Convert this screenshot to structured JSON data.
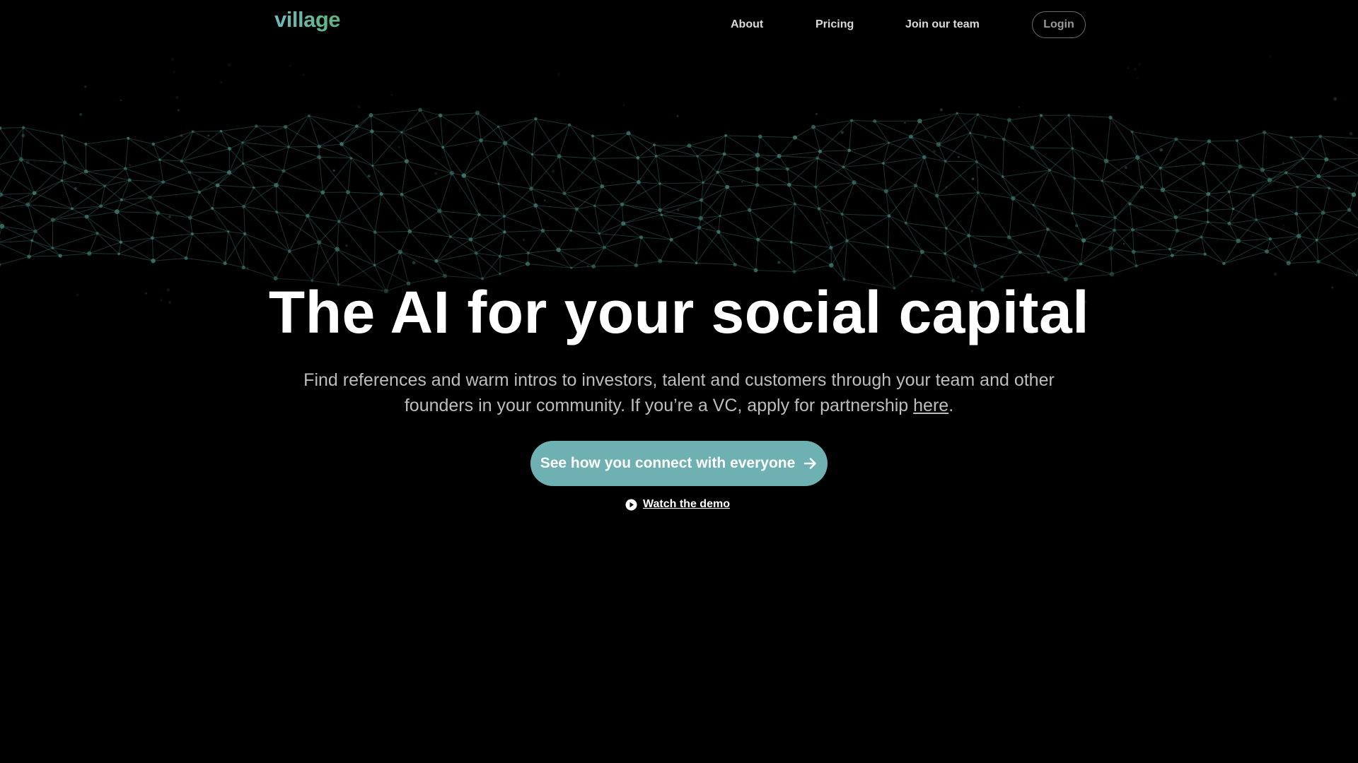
{
  "brand": {
    "logo_text": "village",
    "logo_colors": [
      "#6fb8bd",
      "#5db27e"
    ]
  },
  "nav": {
    "links": [
      {
        "label": "About"
      },
      {
        "label": "Pricing"
      },
      {
        "label": "Join our team"
      }
    ],
    "login_label": "Login"
  },
  "hero": {
    "title": "The AI for your social capital",
    "subtitle_text": "Find references and warm intros to investors, talent and customers through your team and other founders in your community. If you’re a VC, apply for partnership ",
    "subtitle_link": "here",
    "subtitle_end": ".",
    "cta_label": "See how you connect with everyone",
    "cta_icon": "arrow-right-icon",
    "demo_label": "Watch the demo",
    "demo_icon": "play-circle-icon"
  },
  "colors": {
    "background": "#000000",
    "accent": "#6fb1b3",
    "mesh": "#2f5f57"
  }
}
